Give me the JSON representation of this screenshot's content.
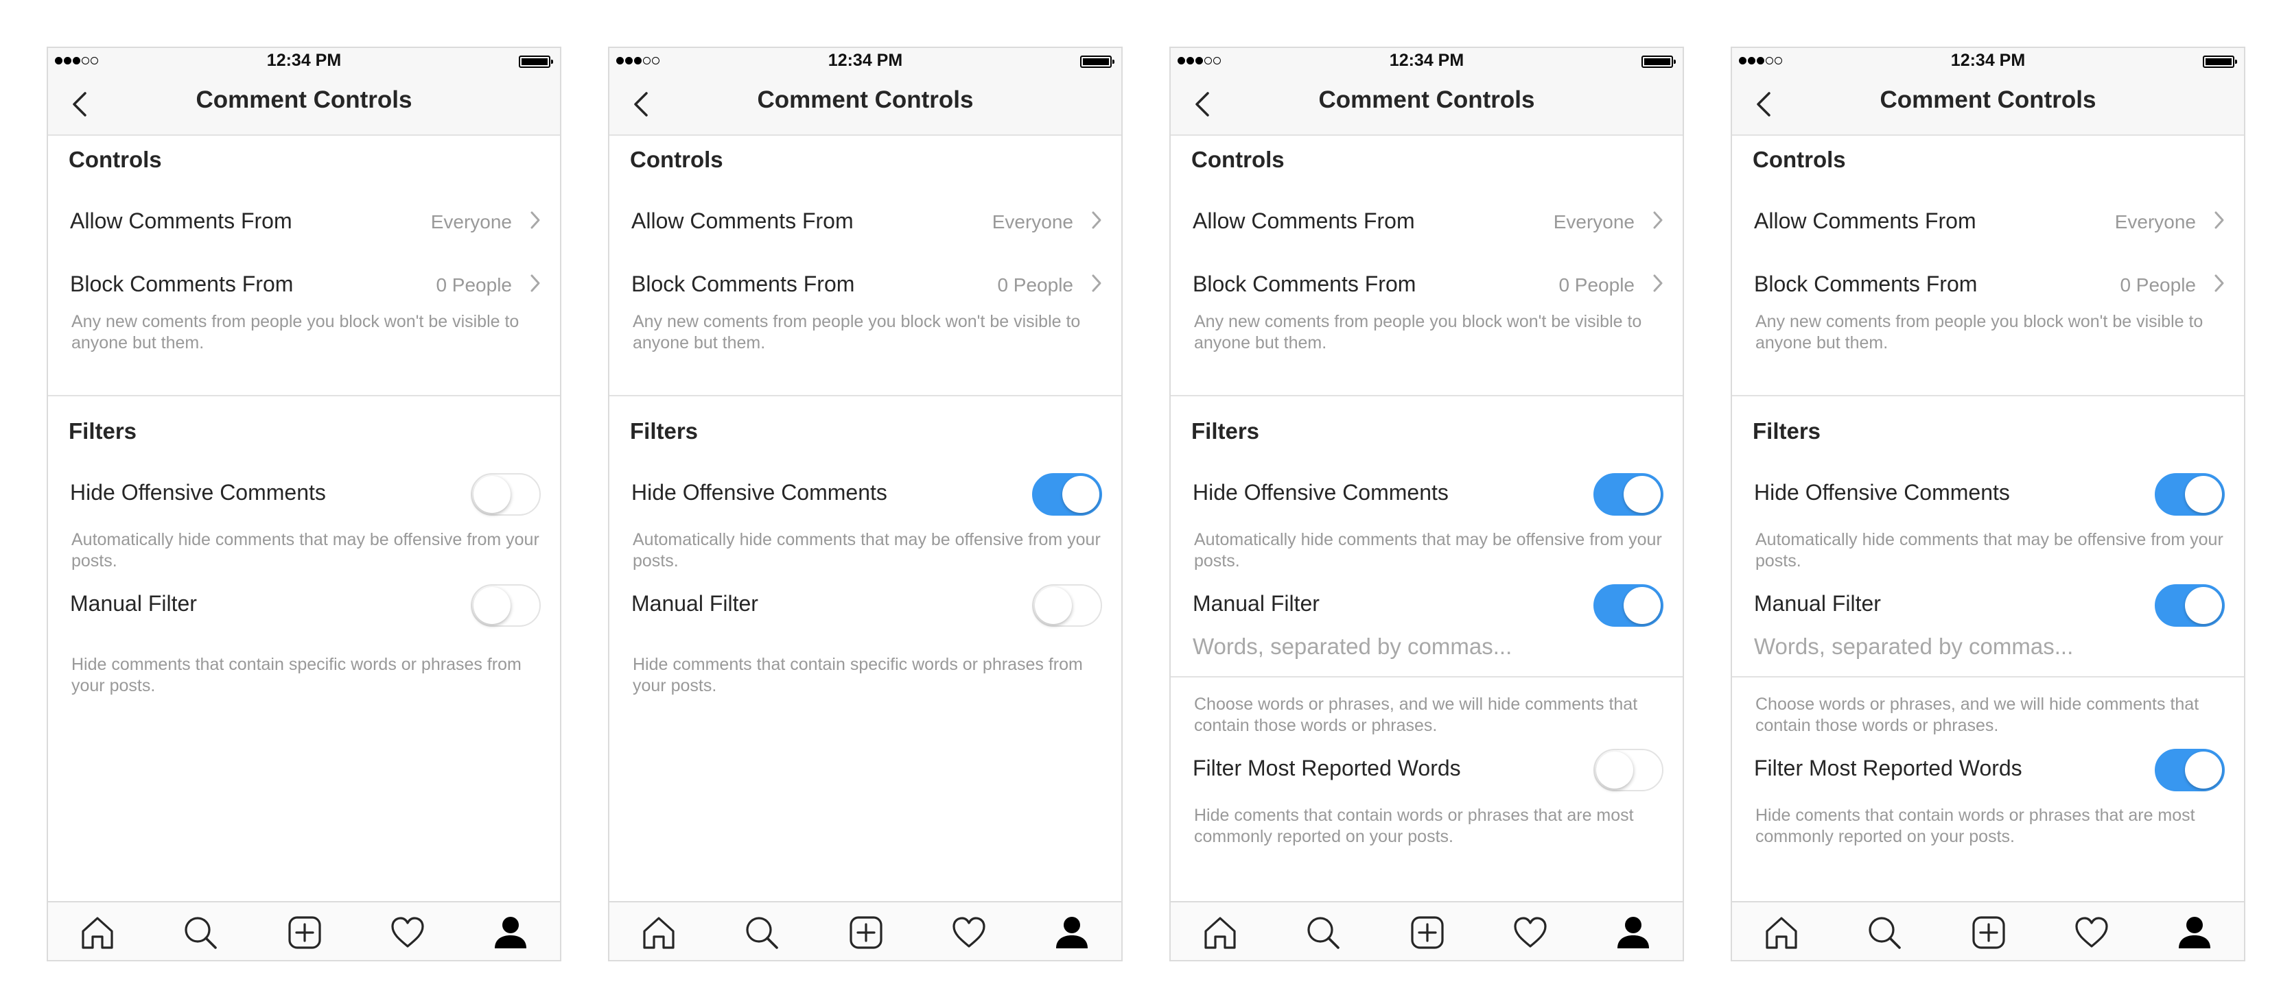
{
  "screens": [
    {
      "status": {
        "time": "12:34 PM"
      },
      "header": {
        "title": "Comment Controls"
      },
      "controls": {
        "heading": "Controls",
        "allow_label": "Allow Comments From",
        "allow_value": "Everyone",
        "block_label": "Block Comments From",
        "block_value": "0 People",
        "block_desc": "Any new coments from people you block won't be visible to anyone but them."
      },
      "filters": {
        "heading": "Filters",
        "offensive_label": "Hide Offensive Comments",
        "offensive_desc": "Automatically hide comments that may be offensive from your posts.",
        "offensive_on": false,
        "manual_label": "Manual Filter",
        "manual_on": false,
        "manual_desc": "Hide comments that contain specific words or phrases from your posts."
      }
    },
    {
      "status": {
        "time": "12:34 PM"
      },
      "header": {
        "title": "Comment Controls"
      },
      "controls": {
        "heading": "Controls",
        "allow_label": "Allow Comments From",
        "allow_value": "Everyone",
        "block_label": "Block Comments From",
        "block_value": "0 People",
        "block_desc": "Any new coments from people you block won't be visible to anyone but them."
      },
      "filters": {
        "heading": "Filters",
        "offensive_label": "Hide Offensive Comments",
        "offensive_desc": "Automatically hide comments that may be offensive from your posts.",
        "offensive_on": true,
        "manual_label": "Manual Filter",
        "manual_on": false,
        "manual_desc": "Hide comments that contain specific words or phrases from your posts."
      }
    },
    {
      "status": {
        "time": "12:34 PM"
      },
      "header": {
        "title": "Comment Controls"
      },
      "controls": {
        "heading": "Controls",
        "allow_label": "Allow Comments From",
        "allow_value": "Everyone",
        "block_label": "Block Comments From",
        "block_value": "0 People",
        "block_desc": "Any new coments from people you block won't be visible to anyone but them."
      },
      "filters": {
        "heading": "Filters",
        "offensive_label": "Hide Offensive Comments",
        "offensive_desc": "Automatically hide comments that may be offensive from your posts.",
        "offensive_on": true,
        "manual_label": "Manual Filter",
        "manual_on": true,
        "words_placeholder": "Words, separated by commas...",
        "words_desc": "Choose words or phrases, and we will hide comments that contain those words or phrases.",
        "reported_label": "Filter Most Reported Words",
        "reported_on": false,
        "reported_desc": "Hide coments that contain words or phrases that are most commonly reported on your posts."
      }
    },
    {
      "status": {
        "time": "12:34 PM"
      },
      "header": {
        "title": "Comment Controls"
      },
      "controls": {
        "heading": "Controls",
        "allow_label": "Allow Comments From",
        "allow_value": "Everyone",
        "block_label": "Block Comments From",
        "block_value": "0 People",
        "block_desc": "Any new coments from people you block won't be visible to anyone but them."
      },
      "filters": {
        "heading": "Filters",
        "offensive_label": "Hide Offensive Comments",
        "offensive_desc": "Automatically hide comments that may be offensive from your posts.",
        "offensive_on": true,
        "manual_label": "Manual Filter",
        "manual_on": true,
        "words_placeholder": "Words, separated by commas...",
        "words_desc": "Choose words or phrases, and we will hide comments that contain those words or phrases.",
        "reported_label": "Filter Most Reported Words",
        "reported_on": true,
        "reported_desc": "Hide coments that contain words or phrases that are most commonly reported on your posts."
      }
    }
  ],
  "tabbar": {
    "icons": [
      "home-icon",
      "search-icon",
      "add-post-icon",
      "activity-heart-icon",
      "profile-icon"
    ]
  },
  "colors": {
    "toggle_on": "#3897f0",
    "secondary_text": "#999999",
    "divider": "#e2e2e2"
  }
}
